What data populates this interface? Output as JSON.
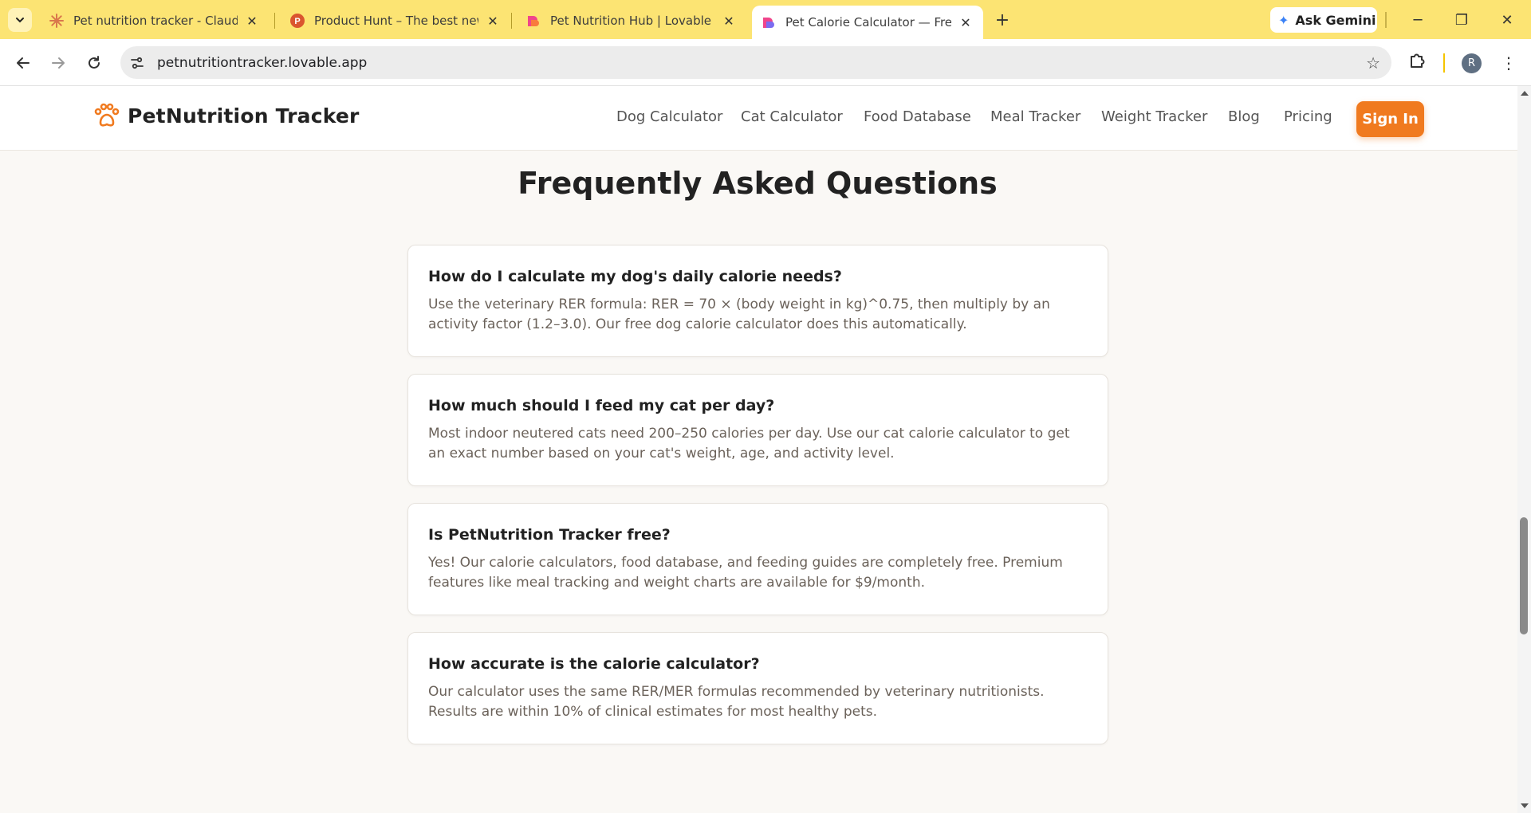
{
  "browser": {
    "tabs": [
      {
        "title": "Pet nutrition tracker - Claude",
        "icon": "claude-icon"
      },
      {
        "title": "Product Hunt – The best new products",
        "icon": "product-hunt-icon"
      },
      {
        "title": "Pet Nutrition Hub | Lovable",
        "icon": "lovable-icon"
      },
      {
        "title": "Pet Calorie Calculator — Free Dog & Cat",
        "icon": "lovable-icon",
        "active": true
      }
    ],
    "ask_gemini": "Ask Gemini",
    "url": "petnutritiontracker.lovable.app",
    "profile_initial": "R"
  },
  "site": {
    "brand": "PetNutrition Tracker",
    "nav": [
      "Dog Calculator",
      "Cat Calculator",
      "Food Database",
      "Meal Tracker",
      "Weight Tracker",
      "Blog",
      "Pricing"
    ],
    "sign_in": "Sign In",
    "accent": "#f07a1f"
  },
  "faq": {
    "title": "Frequently Asked Questions",
    "items": [
      {
        "q": "How do I calculate my dog's daily calorie needs?",
        "a": "Use the veterinary RER formula: RER = 70 × (body weight in kg)^0.75, then multiply by an activity factor (1.2–3.0). Our free dog calorie calculator does this automatically."
      },
      {
        "q": "How much should I feed my cat per day?",
        "a": "Most indoor neutered cats need 200–250 calories per day. Use our cat calorie calculator to get an exact number based on your cat's weight, age, and activity level."
      },
      {
        "q": "Is PetNutrition Tracker free?",
        "a": "Yes! Our calorie calculators, food database, and feeding guides are completely free. Premium features like meal tracking and weight charts are available for $9/month."
      },
      {
        "q": "How accurate is the calorie calculator?",
        "a": "Our calculator uses the same RER/MER formulas recommended by veterinary nutritionists. Results are within 10% of clinical estimates for most healthy pets."
      }
    ]
  }
}
